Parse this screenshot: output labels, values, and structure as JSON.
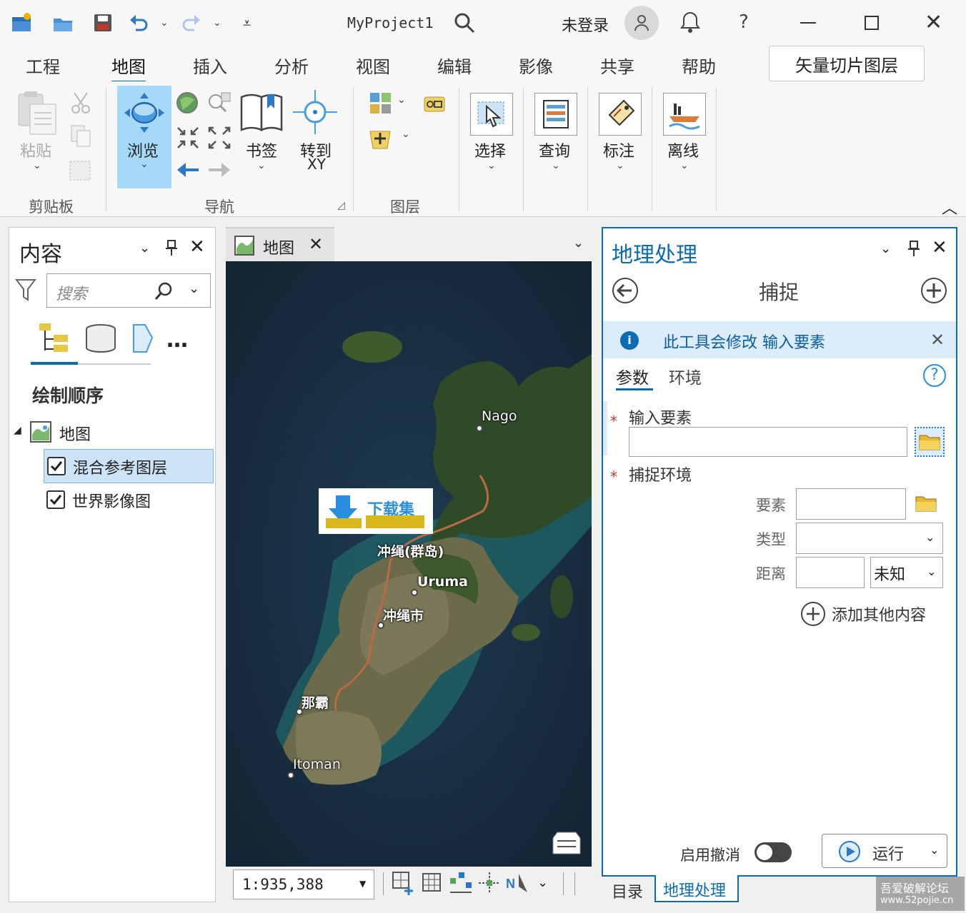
{
  "window": {
    "title": "MyProject1",
    "user_status": "未登录"
  },
  "ribbon": {
    "tabs": [
      "工程",
      "地图",
      "插入",
      "分析",
      "视图",
      "编辑",
      "影像",
      "共享",
      "帮助"
    ],
    "active_tab": "地图",
    "context_tab": "矢量切片图层",
    "clipboard": {
      "paste": "粘贴",
      "group": "剪贴板"
    },
    "navigation": {
      "explore": "浏览",
      "bookmarks": "书签",
      "goto_line1": "转到",
      "goto_line2": "XY",
      "group": "导航"
    },
    "layer": {
      "group": "图层"
    },
    "selection": {
      "select": "选择",
      "query": "查询",
      "label": "标注",
      "offline": "离线"
    }
  },
  "contents": {
    "title": "内容",
    "search_placeholder": "搜索",
    "drawing_order": "绘制顺序",
    "map_item": "地图",
    "layers": [
      {
        "name": "混合参考图层",
        "checked": true,
        "selected": true
      },
      {
        "name": "世界影像图",
        "checked": true,
        "selected": false
      }
    ]
  },
  "map_view": {
    "tab_label": "地图",
    "scale": "1:935,388",
    "labels": {
      "nago": "Nago",
      "okinawa_islands": "冲绳(群岛)",
      "uruma": "Uruma",
      "okinawa_city": "冲绳市",
      "naha": "那霸",
      "itoman": "Itoman"
    },
    "watermark": "下载集"
  },
  "geoprocessing": {
    "title": "地理处理",
    "tool_name": "捕捉",
    "info_message": "此工具会修改 输入要素",
    "tabs": [
      "参数",
      "环境"
    ],
    "input_features_label": "输入要素",
    "snap_env_label": "捕捉环境",
    "feature_label": "要素",
    "type_label": "类型",
    "distance_label": "距离",
    "distance_unit": "未知",
    "add_more": "添加其他内容",
    "enable_undo": "启用撤消",
    "run": "运行",
    "bottom_tabs": [
      "目录",
      "地理处理"
    ]
  },
  "corner_watermark": {
    "line1": "吾爱破解论坛",
    "line2": "www.52pojie.cn"
  },
  "colors": {
    "accent": "#0a6cb5",
    "selected_bg": "#cde4f7",
    "info_bg": "#dcecf8",
    "explore_bg": "#a6d8f7",
    "required": "#c0392b"
  }
}
